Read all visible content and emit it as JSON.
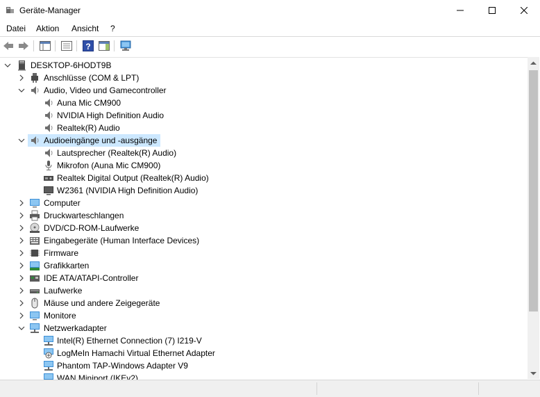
{
  "window": {
    "title": "Geräte-Manager"
  },
  "menu": {
    "file": "Datei",
    "action": "Aktion",
    "view": "Ansicht",
    "help": "?"
  },
  "toolbar": {
    "icons": [
      "back-icon",
      "forward-icon",
      "show-hide-console-tree-icon",
      "properties-icon",
      "help-icon",
      "action-pane-icon",
      "scan-hardware-icon"
    ]
  },
  "tree": {
    "root": "DESKTOP-6HODT9B",
    "categories": {
      "ports": "Anschlüsse (COM & LPT)",
      "audio": "Audio, Video und Gamecontroller",
      "audio_items": [
        "Auna Mic CM900",
        "NVIDIA High Definition Audio",
        "Realtek(R) Audio"
      ],
      "audio_io": "Audioeingänge und -ausgänge",
      "audio_io_items": [
        "Lautsprecher (Realtek(R) Audio)",
        "Mikrofon (Auna Mic CM900)",
        "Realtek Digital Output (Realtek(R) Audio)",
        "W2361 (NVIDIA High Definition Audio)"
      ],
      "computer": "Computer",
      "printq": "Druckwarteschlangen",
      "dvd": "DVD/CD-ROM-Laufwerke",
      "hid": "Eingabegeräte (Human Interface Devices)",
      "firmware": "Firmware",
      "gpu": "Grafikkarten",
      "ide": "IDE ATA/ATAPI-Controller",
      "drives": "Laufwerke",
      "mice": "Mäuse und andere Zeigegeräte",
      "monitors": "Monitore",
      "network": "Netzwerkadapter",
      "network_items": [
        "Intel(R) Ethernet Connection (7) I219-V",
        "LogMeIn Hamachi Virtual Ethernet Adapter",
        "Phantom TAP-Windows Adapter V9",
        "WAN Miniport (IKEv2)"
      ]
    }
  },
  "colors": {
    "selection": "#cce8ff",
    "scroll_thumb": "#c1c1c1",
    "monitor_blue": "#3d8fd6"
  }
}
